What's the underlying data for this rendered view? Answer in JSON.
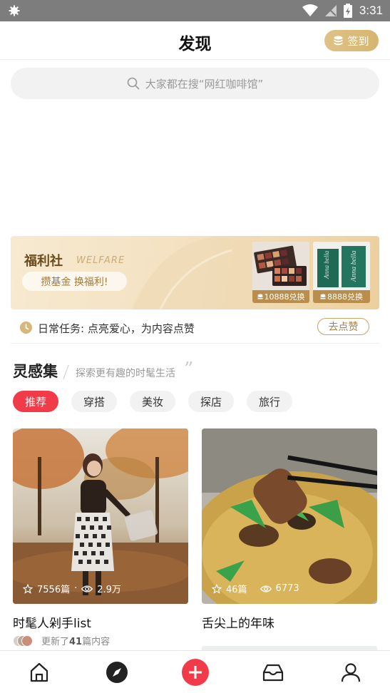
{
  "status_bar": {
    "time": "3:31"
  },
  "header": {
    "title": "发现",
    "signin_label": "签到"
  },
  "search": {
    "placeholder": "大家都在搜“网红咖啡馆”"
  },
  "welfare": {
    "title": "福利社",
    "title_en": "WELFARE",
    "slogan": "攒基金 换福利!",
    "products": [
      {
        "price": "10888兑换"
      },
      {
        "price": "8888兑换"
      }
    ]
  },
  "daily_task": {
    "text": "日常任务: 点亮爱心，为内容点赞",
    "button": "去点赞"
  },
  "inspiration": {
    "title": "灵感集",
    "subtitle": "探索更有趣的时髦生活",
    "quote_mark": "”",
    "tags": [
      "推荐",
      "穿搭",
      "美妆",
      "探店",
      "旅行"
    ]
  },
  "cards": [
    {
      "name": "时髦人剁手list",
      "likes": "7556篇",
      "views": "2.9万",
      "update_prefix": "更新了",
      "update_count": "41",
      "update_suffix": "篇内容"
    },
    {
      "name": "舌尖上的年味",
      "likes": "46篇",
      "views": "6773"
    }
  ],
  "colors": {
    "accent": "#f23b48",
    "gold": "#d6b56f"
  },
  "icons": [
    "settings-icon",
    "wifi-icon",
    "signal-icon",
    "battery-icon",
    "coin-icon",
    "search-icon",
    "clock-icon",
    "star-icon",
    "eye-icon",
    "home-icon",
    "compass-icon",
    "add-icon",
    "inbox-icon",
    "user-icon"
  ]
}
